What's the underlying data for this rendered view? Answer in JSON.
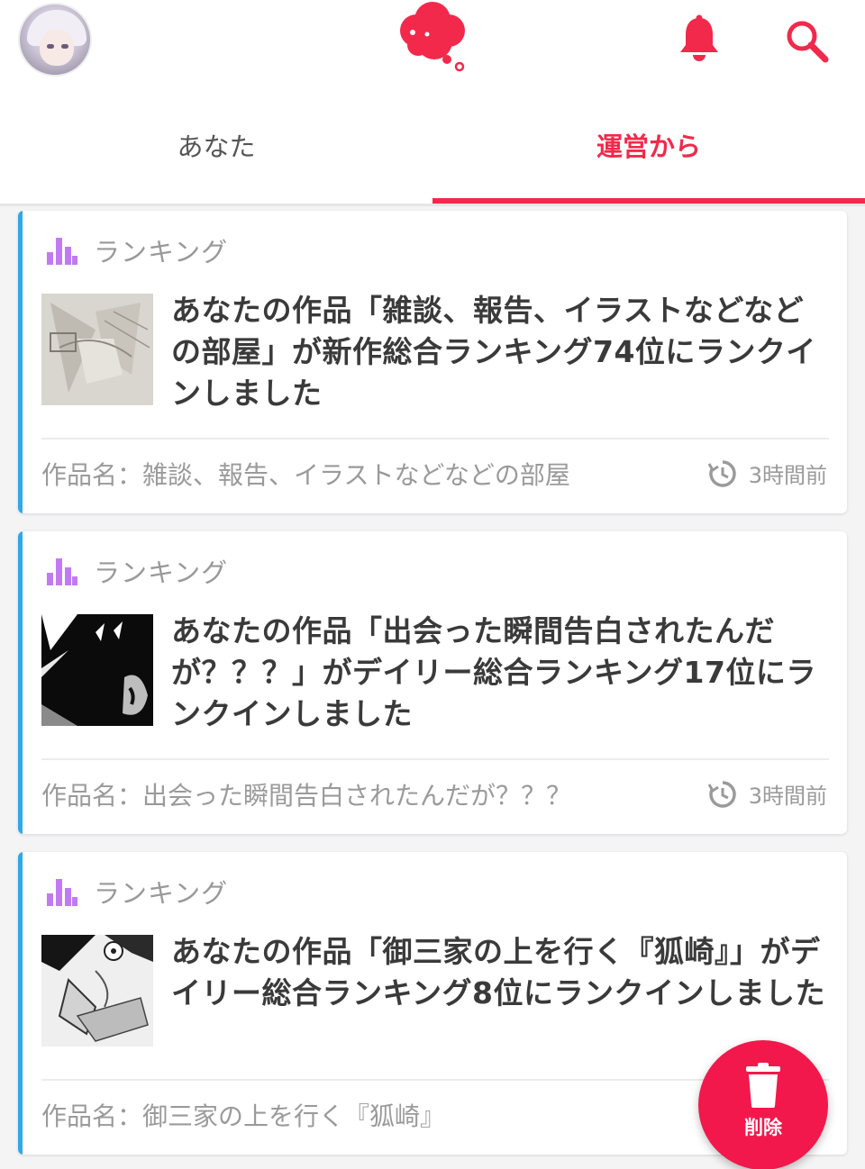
{
  "header": {
    "avatar_icon": "user-avatar",
    "logo_icon": "speech-cloud-logo",
    "bell_icon": "bell-icon",
    "search_icon": "search-icon",
    "accent_color": "#f2294b"
  },
  "tabs": [
    {
      "label": "あなた",
      "active": false
    },
    {
      "label": "運営から",
      "active": true
    }
  ],
  "notifications": [
    {
      "category": "ランキング",
      "headline": "あなたの作品「雑談、報告、イラストなどなどの部屋」が新作総合ランキング74位にランクインしました",
      "work": "作品名：雑談、報告、イラストなどなどの部屋",
      "time": "3時間前"
    },
    {
      "category": "ランキング",
      "headline": "あなたの作品「出会った瞬間告白されたんだが？？？」がデイリー総合ランキング17位にランクインしました",
      "work": "作品名：出会った瞬間告白されたんだが？？？",
      "time": "3時間前"
    },
    {
      "category": "ランキング",
      "headline": "あなたの作品「御三家の上を行く『狐崎』」がデイリー総合ランキング8位にランクインしました",
      "work": "作品名：御三家の上を行く『狐崎』",
      "time": ""
    }
  ],
  "fab": {
    "label": "削除",
    "icon": "trash-icon",
    "color": "#f2184b"
  }
}
